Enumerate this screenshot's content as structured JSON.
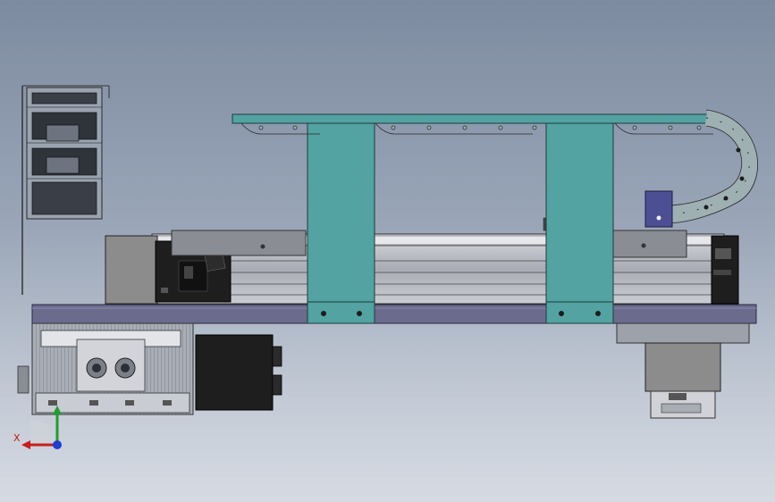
{
  "triad": {
    "x_label": "X",
    "x_color": "#c81e1e",
    "y_color": "#1f9e2c",
    "z_color": "#1f3fd0"
  },
  "colors": {
    "plate": "#6b6b8e",
    "gantry": "#52a3a1",
    "rail": "#b9bcc4",
    "motor_dark": "#1e1e1e",
    "motor_grey": "#8c8c8c",
    "chain": "#9fb0b3"
  }
}
